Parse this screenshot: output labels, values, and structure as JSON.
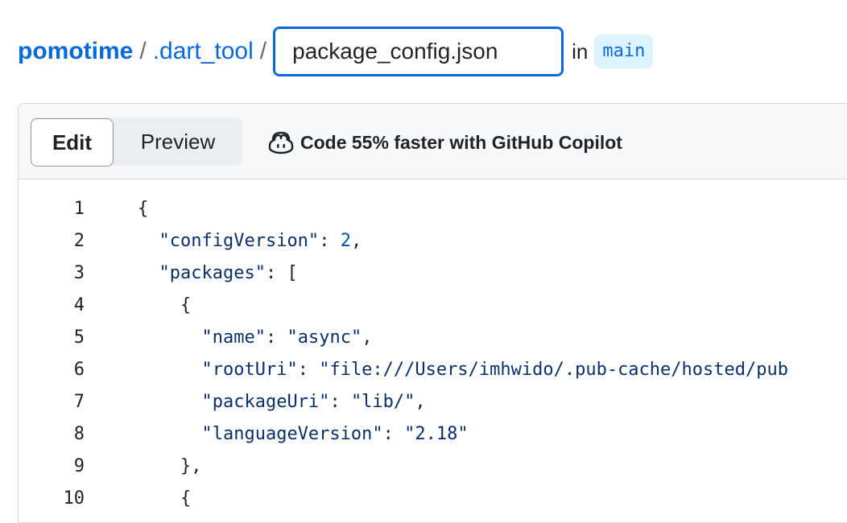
{
  "breadcrumb": {
    "repo": "pomotime",
    "separator": "/",
    "directory": ".dart_tool",
    "filename_value": "package_config.json",
    "in_word": "in",
    "branch": "main"
  },
  "toolbar": {
    "edit_label": "Edit",
    "preview_label": "Preview",
    "copilot_promo": "Code 55% faster with GitHub Copilot"
  },
  "code": {
    "lines": [
      {
        "n": "1",
        "indent": "",
        "tokens": [
          {
            "t": "punc",
            "v": "{"
          }
        ]
      },
      {
        "n": "2",
        "indent": "  ",
        "tokens": [
          {
            "t": "key",
            "v": "\"configVersion\""
          },
          {
            "t": "punc",
            "v": ": "
          },
          {
            "t": "num",
            "v": "2"
          },
          {
            "t": "punc",
            "v": ","
          }
        ]
      },
      {
        "n": "3",
        "indent": "  ",
        "tokens": [
          {
            "t": "key",
            "v": "\"packages\""
          },
          {
            "t": "punc",
            "v": ": ["
          }
        ]
      },
      {
        "n": "4",
        "indent": "    ",
        "tokens": [
          {
            "t": "punc",
            "v": "{"
          }
        ]
      },
      {
        "n": "5",
        "indent": "      ",
        "tokens": [
          {
            "t": "key",
            "v": "\"name\""
          },
          {
            "t": "punc",
            "v": ": "
          },
          {
            "t": "str",
            "v": "\"async\""
          },
          {
            "t": "punc",
            "v": ","
          }
        ]
      },
      {
        "n": "6",
        "indent": "      ",
        "tokens": [
          {
            "t": "key",
            "v": "\"rootUri\""
          },
          {
            "t": "punc",
            "v": ": "
          },
          {
            "t": "str",
            "v": "\"file:///Users/imhwido/.pub-cache/hosted/pub"
          }
        ]
      },
      {
        "n": "7",
        "indent": "      ",
        "tokens": [
          {
            "t": "key",
            "v": "\"packageUri\""
          },
          {
            "t": "punc",
            "v": ": "
          },
          {
            "t": "str",
            "v": "\"lib/\""
          },
          {
            "t": "punc",
            "v": ","
          }
        ]
      },
      {
        "n": "8",
        "indent": "      ",
        "tokens": [
          {
            "t": "key",
            "v": "\"languageVersion\""
          },
          {
            "t": "punc",
            "v": ": "
          },
          {
            "t": "str",
            "v": "\"2.18\""
          }
        ]
      },
      {
        "n": "9",
        "indent": "    ",
        "tokens": [
          {
            "t": "punc",
            "v": "},"
          }
        ]
      },
      {
        "n": "10",
        "indent": "    ",
        "tokens": [
          {
            "t": "punc",
            "v": "{"
          }
        ]
      }
    ]
  },
  "colors": {
    "accent": "#0969da",
    "badge_bg": "#ddf4ff",
    "json_string": "#0a3069",
    "json_number": "#0550ae"
  }
}
